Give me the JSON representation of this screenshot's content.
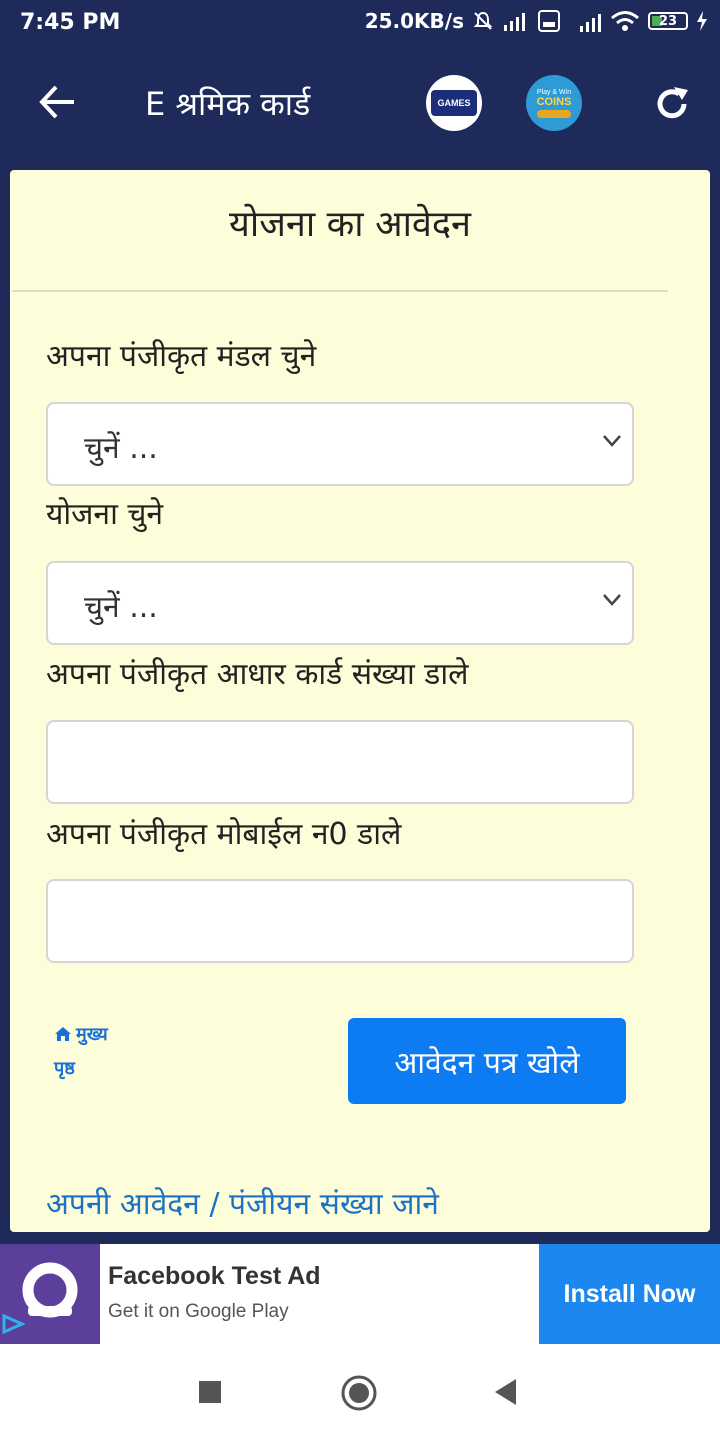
{
  "status_bar": {
    "time": "7:45 PM",
    "net_speed": "25.0KB/s",
    "battery": "23"
  },
  "app_bar": {
    "title": "E श्रमिक कार्ड",
    "games_logo_text": "GAMES",
    "coins_logo_top": "Play & Win",
    "coins_logo_text": "COINS"
  },
  "form": {
    "title": "योजना का आवेदन",
    "mandal_label": "अपना पंजीकृत मंडल चुने",
    "mandal_selected": "चुनें ...",
    "yojana_label": "योजना चुने",
    "yojana_selected": "चुनें ...",
    "aadhaar_label": "अपना पंजीकृत आधार कार्ड संख्या डाले",
    "aadhaar_value": "",
    "mobile_label": "अपना पंजीकृत मोबाईल न0 डाले",
    "mobile_value": "",
    "home_link_line1": "मुख्य",
    "home_link_line2": "पृष्ठ",
    "submit_label": "आवेदन पत्र खोले",
    "bottom_link": "अपनी आवेदन / पंजीयन संख्या जाने"
  },
  "ad": {
    "title": "Facebook Test Ad",
    "subtitle": "Get it on Google Play",
    "install_label": "Install Now"
  },
  "colors": {
    "header_bg": "#1e2a5a",
    "card_bg": "#fefdd9",
    "primary_button": "#0d7bf2",
    "link": "#1a73c9",
    "ad_button": "#1d87f0"
  },
  "icons": [
    "back-arrow-icon",
    "refresh-icon",
    "chevron-down-icon",
    "home-icon",
    "stop-square-icon",
    "home-circle-icon",
    "back-triangle-icon",
    "mute-icon",
    "signal-icon",
    "wifi-icon",
    "battery-icon",
    "adchoices-icon"
  ]
}
